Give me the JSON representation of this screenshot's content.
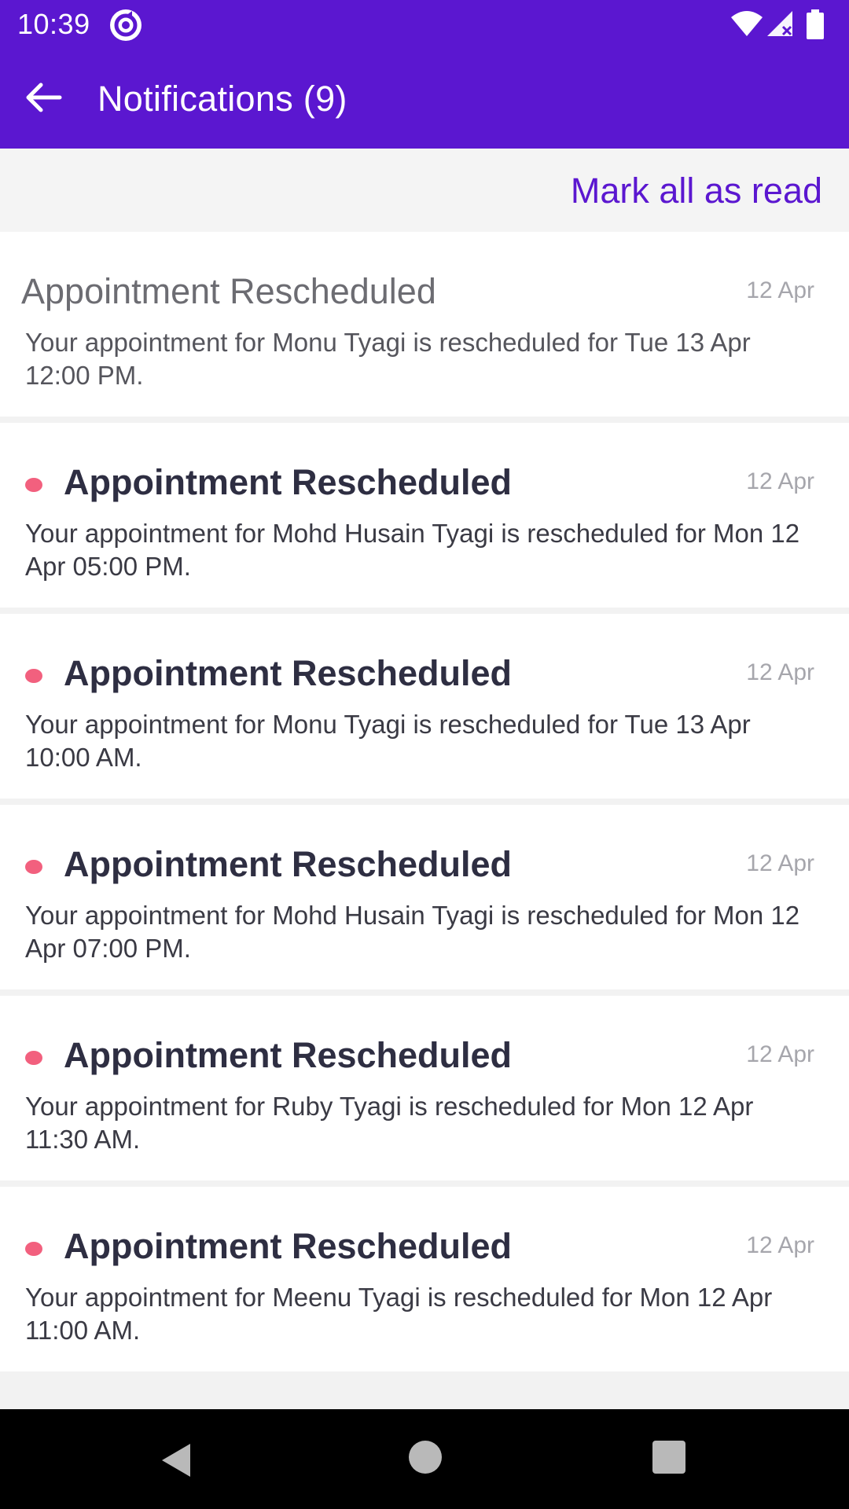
{
  "status_bar": {
    "time": "10:39",
    "icons": [
      "app-sync-icon",
      "wifi-icon",
      "signal-icon",
      "battery-icon"
    ]
  },
  "app_bar": {
    "title": "Notifications (9)",
    "back_icon": "arrow-left-icon"
  },
  "actions": {
    "mark_all_label": "Mark all as read"
  },
  "notifications": [
    {
      "title": "Appointment Rescheduled",
      "date": "12 Apr",
      "body": "Your appointment for Monu Tyagi is rescheduled for Tue 13 Apr 12:00 PM.",
      "unread": false
    },
    {
      "title": "Appointment Rescheduled",
      "date": "12 Apr",
      "body": "Your appointment for Mohd Husain Tyagi is rescheduled for Mon 12 Apr 05:00 PM.",
      "unread": true
    },
    {
      "title": "Appointment Rescheduled",
      "date": "12 Apr",
      "body": "Your appointment for Monu Tyagi is rescheduled for Tue 13 Apr 10:00 AM.",
      "unread": true
    },
    {
      "title": "Appointment Rescheduled",
      "date": "12 Apr",
      "body": "Your appointment for Mohd Husain Tyagi is rescheduled for Mon 12 Apr 07:00 PM.",
      "unread": true
    },
    {
      "title": "Appointment Rescheduled",
      "date": "12 Apr",
      "body": "Your appointment for Ruby Tyagi is rescheduled for Mon 12 Apr 11:30 AM.",
      "unread": true
    },
    {
      "title": "Appointment Rescheduled",
      "date": "12 Apr",
      "body": "Your appointment for Meenu Tyagi is rescheduled for Mon 12 Apr 11:00 AM.",
      "unread": true
    }
  ],
  "colors": {
    "primary": "#5b17d0",
    "unread_dot": "#f2607e",
    "background": "#f2f2f2"
  },
  "nav_bar": {
    "icons": [
      "back-triangle-icon",
      "home-circle-icon",
      "recents-square-icon"
    ]
  }
}
